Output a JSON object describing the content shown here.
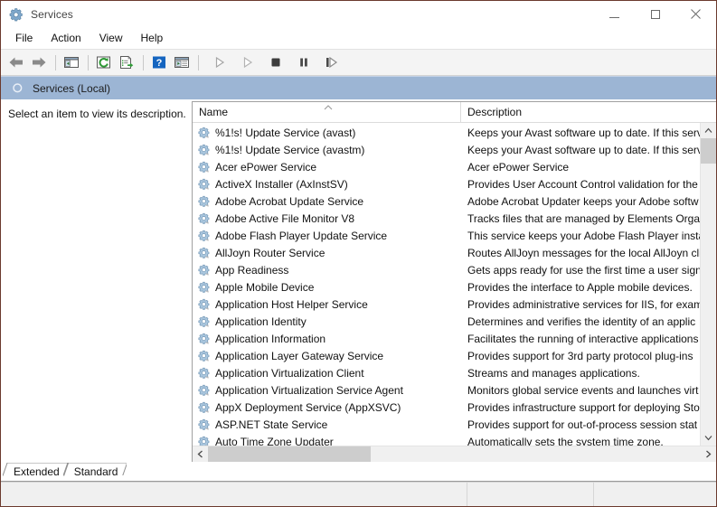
{
  "window": {
    "title": "Services",
    "title_icon": "services-gear-icon",
    "caption": {
      "minimize": "minimize-icon",
      "maximize": "maximize-icon",
      "close": "close-icon"
    },
    "accent_titlebar": "#ffffff",
    "border_color": "#6b3a2e"
  },
  "menubar": {
    "items": [
      {
        "label": "File",
        "name": "menu-file"
      },
      {
        "label": "Action",
        "name": "menu-action"
      },
      {
        "label": "View",
        "name": "menu-view"
      },
      {
        "label": "Help",
        "name": "menu-help"
      }
    ]
  },
  "toolbar": {
    "buttons": [
      {
        "name": "back-arrow-icon",
        "icon": "arrow-left",
        "enabled": true
      },
      {
        "name": "forward-arrow-icon",
        "icon": "arrow-right",
        "enabled": true
      },
      {
        "name": "separator-1",
        "icon": "separator",
        "enabled": false
      },
      {
        "name": "show-hide-console-tree-icon",
        "icon": "console-tree",
        "enabled": true
      },
      {
        "name": "separator-2",
        "icon": "separator",
        "enabled": false
      },
      {
        "name": "refresh-icon",
        "icon": "refresh",
        "enabled": true
      },
      {
        "name": "export-list-icon",
        "icon": "export-list",
        "enabled": true
      },
      {
        "name": "separator-3",
        "icon": "separator",
        "enabled": false
      },
      {
        "name": "help-icon",
        "icon": "help",
        "enabled": true
      },
      {
        "name": "properties-icon",
        "icon": "properties",
        "enabled": true
      },
      {
        "name": "separator-4",
        "icon": "separator",
        "enabled": false
      },
      {
        "name": "start-service-icon",
        "icon": "play",
        "enabled": false
      },
      {
        "name": "resume-service-icon",
        "icon": "play-2",
        "enabled": false
      },
      {
        "name": "stop-service-icon",
        "icon": "stop",
        "enabled": true
      },
      {
        "name": "pause-service-icon",
        "icon": "pause",
        "enabled": true
      },
      {
        "name": "restart-service-icon",
        "icon": "restart",
        "enabled": true
      }
    ]
  },
  "scope_band": {
    "label": "Services (Local)",
    "icon": "services-gear-icon",
    "background": "#9cb5d4"
  },
  "left_pane": {
    "placeholder_text": "Select an item to view its description."
  },
  "list": {
    "columns": [
      {
        "label": "Name",
        "name": "column-header-name",
        "sort": "ascending"
      },
      {
        "label": "Description",
        "name": "column-header-description",
        "sort": "none"
      }
    ],
    "sort_indicator": "chevron-up-icon",
    "rows": [
      {
        "name": "%1!s! Update Service (avast)",
        "description": "Keeps your Avast software up to date. If this serv"
      },
      {
        "name": "%1!s! Update Service (avastm)",
        "description": "Keeps your Avast software up to date. If this serv"
      },
      {
        "name": "Acer ePower Service",
        "description": "Acer ePower Service"
      },
      {
        "name": "ActiveX Installer (AxInstSV)",
        "description": "Provides User Account Control validation for the"
      },
      {
        "name": "Adobe Acrobat Update Service",
        "description": "Adobe Acrobat Updater keeps your Adobe softw"
      },
      {
        "name": "Adobe Active File Monitor V8",
        "description": "Tracks files that are managed by Elements Organ"
      },
      {
        "name": "Adobe Flash Player Update Service",
        "description": "This service keeps your Adobe Flash Player insta"
      },
      {
        "name": "AllJoyn Router Service",
        "description": "Routes AllJoyn messages for the local AllJoyn cli"
      },
      {
        "name": "App Readiness",
        "description": "Gets apps ready for use the first time a user signs"
      },
      {
        "name": "Apple Mobile Device",
        "description": "Provides the interface to Apple mobile devices."
      },
      {
        "name": "Application Host Helper Service",
        "description": "Provides administrative services for IIS, for exam"
      },
      {
        "name": "Application Identity",
        "description": "Determines and verifies the identity of an applic"
      },
      {
        "name": "Application Information",
        "description": "Facilitates the running of interactive applications"
      },
      {
        "name": "Application Layer Gateway Service",
        "description": "Provides support for 3rd party protocol plug-ins"
      },
      {
        "name": "Application Virtualization Client",
        "description": "Streams and manages applications."
      },
      {
        "name": "Application Virtualization Service Agent",
        "description": "Monitors global service events and launches virt"
      },
      {
        "name": "AppX Deployment Service (AppXSVC)",
        "description": "Provides infrastructure support for deploying Sto"
      },
      {
        "name": "ASP.NET State Service",
        "description": "Provides support for out-of-process session stat"
      },
      {
        "name": "Auto Time Zone Updater",
        "description": "Automatically sets the system time zone."
      }
    ],
    "row_icon": "service-gear-icon"
  },
  "scrollbars": {
    "vertical": {
      "up_icon": "chevron-up-icon",
      "down_icon": "chevron-down-icon",
      "thumb_position_percent": 0,
      "thumb_size_percent": 8
    },
    "horizontal": {
      "left_icon": "chevron-left-icon",
      "right_icon": "chevron-right-icon",
      "thumb_position_percent": 0,
      "thumb_size_percent": 33
    }
  },
  "tabs": [
    {
      "label": "Extended",
      "name": "tab-extended",
      "active": false
    },
    {
      "label": "Standard",
      "name": "tab-standard",
      "active": true
    }
  ],
  "statusbar": {
    "pane_1": "",
    "pane_2": "",
    "pane_3": ""
  }
}
